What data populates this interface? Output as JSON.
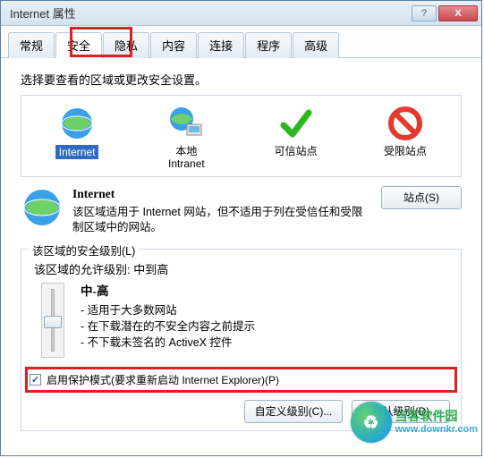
{
  "window": {
    "title": "Internet 属性"
  },
  "titlebar_buttons": {
    "help": "?",
    "close": "X"
  },
  "tabs": {
    "items": [
      "常规",
      "安全",
      "隐私",
      "内容",
      "连接",
      "程序",
      "高级"
    ],
    "active_index": 1
  },
  "zone_select_label": "选择要查看的区域或更改安全设置。",
  "zones": {
    "items": [
      {
        "label": "Internet",
        "selected": true
      },
      {
        "label": "本地\nIntranet",
        "selected": false
      },
      {
        "label": "可信站点",
        "selected": false
      },
      {
        "label": "受限站点",
        "selected": false
      }
    ]
  },
  "zone_desc": {
    "heading": "Internet",
    "body": "该区域适用于 Internet 网站，但不适用于列在受信任和受限制区域中的网站。"
  },
  "sites_button": "站点(S)",
  "security_group_legend": "该区域的安全级别(L)",
  "allowed_levels_line": "该区域的允许级别: 中到高",
  "slider": {
    "level_name": "中-高",
    "bullets": [
      "- 适用于大多数网站",
      "- 在下载潜在的不安全内容之前提示",
      "- 不下载未签名的 ActiveX 控件"
    ]
  },
  "protected_mode": {
    "checked": true,
    "label": "启用保护模式(要求重新启动 Internet Explorer)(P)"
  },
  "buttons": {
    "custom_level": "自定义级别(C)...",
    "default_level": "默认级别(D)"
  },
  "watermark": {
    "cn": "当客软件园",
    "url": "www.downkr.com"
  },
  "colors": {
    "highlight_red": "#d92121",
    "select_blue": "#316ac5"
  }
}
